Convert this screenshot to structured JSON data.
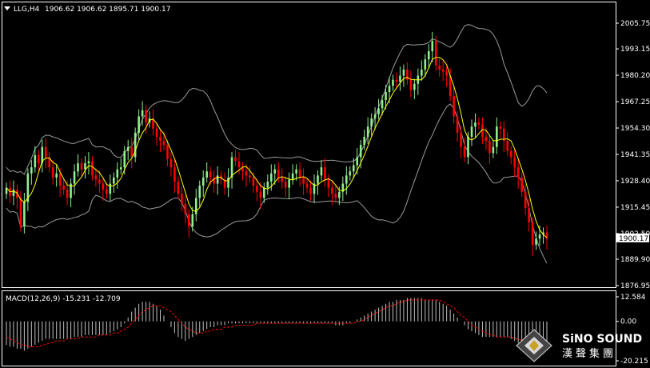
{
  "header": {
    "symbol": "LLG,H4",
    "ohlc": "1906.62 1906.62 1895.71 1900.17"
  },
  "colors": {
    "background": "#000000",
    "axis": "#ffffff",
    "bull": "#90ee90",
    "bear": "#ff0000",
    "bands": "#9a9a9a",
    "ma": "#ffff00",
    "macd_hist": "#c0c0c0",
    "macd_signal": "#ff0000",
    "price_tag_bg": "#ffffff",
    "price_tag_fg": "#000000"
  },
  "chart_data": {
    "type": "candlestick",
    "title": "LLG,H4",
    "price_axis": {
      "ticks": [
        "2005.75",
        "1993.15",
        "1980.20",
        "1967.25",
        "1954.30",
        "1941.35",
        "1928.40",
        "1915.45",
        "1902.50",
        "1889.90",
        "1876.95"
      ],
      "tick_values": [
        2005.75,
        1993.15,
        1980.2,
        1967.25,
        1954.3,
        1941.35,
        1928.4,
        1915.45,
        1902.5,
        1889.9,
        1876.95
      ],
      "last_price": "1900.17",
      "last_price_value": 1900.17
    },
    "candles_close": [
      1925,
      1921,
      1924,
      1920,
      1906,
      1918,
      1932,
      1935,
      1941,
      1937,
      1945,
      1940,
      1935,
      1930,
      1932,
      1926,
      1924,
      1920,
      1927,
      1933,
      1937,
      1934,
      1937,
      1938,
      1931,
      1929,
      1927,
      1924,
      1922,
      1927,
      1930,
      1934,
      1935,
      1943,
      1945,
      1940,
      1952,
      1960,
      1963,
      1957,
      1959,
      1954,
      1950,
      1948,
      1946,
      1939,
      1935,
      1928,
      1922,
      1917,
      1912,
      1906,
      1912,
      1920,
      1926,
      1930,
      1933,
      1930,
      1927,
      1931,
      1929,
      1925,
      1930,
      1940,
      1938,
      1935,
      1933,
      1931,
      1930,
      1926,
      1923,
      1920,
      1925,
      1928,
      1932,
      1934,
      1930,
      1928,
      1925,
      1929,
      1932,
      1934,
      1930,
      1927,
      1925,
      1922,
      1927,
      1931,
      1935,
      1929,
      1925,
      1922,
      1920,
      1923,
      1927,
      1931,
      1933,
      1936,
      1940,
      1946,
      1950,
      1955,
      1959,
      1961,
      1964,
      1968,
      1972,
      1975,
      1978,
      1977,
      1980,
      1983,
      1978,
      1973,
      1976,
      1980,
      1983,
      1988,
      1992,
      1997,
      1985,
      1983,
      1982,
      1980,
      1970,
      1960,
      1952,
      1945,
      1940,
      1950,
      1955,
      1957,
      1956,
      1950,
      1948,
      1942,
      1945,
      1955,
      1954,
      1948,
      1943,
      1940,
      1935,
      1930,
      1923,
      1915,
      1908,
      1897,
      1900,
      1902,
      1903,
      1900
    ],
    "macd": {
      "label": "MACD(12,26,9) -15.231 -12.709",
      "fast": 12,
      "slow": 26,
      "signal": 9,
      "value": -15.231,
      "signal_value": -12.709,
      "axis_ticks": [
        "12.584",
        "0.00",
        "-20.215"
      ],
      "axis_values": [
        12.584,
        0.0,
        -20.215
      ],
      "histogram": [
        -12,
        -13,
        -13,
        -14,
        -14,
        -15,
        -14,
        -13,
        -12,
        -11,
        -10,
        -9,
        -9,
        -9,
        -9,
        -9,
        -9,
        -9,
        -9,
        -8,
        -8,
        -8,
        -7,
        -7,
        -7,
        -7,
        -7,
        -7,
        -7,
        -6,
        -5,
        -4,
        -3,
        -1,
        2,
        5,
        7,
        9,
        10,
        10,
        10,
        9,
        8,
        6,
        3,
        0,
        -3,
        -6,
        -8,
        -9,
        -10,
        -9,
        -8,
        -7,
        -6,
        -5,
        -4,
        -3,
        -3,
        -2,
        -2,
        -2,
        -1,
        -1,
        -1,
        -1,
        -1,
        -1,
        -1,
        -1,
        -1,
        -1,
        -1,
        -1,
        -1,
        -1,
        -1,
        -1,
        -1,
        -1,
        -1,
        -1,
        -1,
        -1,
        -1,
        -1,
        -1,
        -1,
        -1,
        -1,
        -1,
        -1,
        -2,
        -2,
        -2,
        -1,
        -1,
        0,
        1,
        2,
        3,
        4,
        5,
        6,
        7,
        8,
        9,
        10,
        10,
        11,
        11,
        11,
        12,
        12,
        12,
        12,
        12,
        11,
        11,
        11,
        11,
        10,
        9,
        8,
        6,
        4,
        2,
        0,
        -2,
        -4,
        -5,
        -6,
        -7,
        -8,
        -8,
        -8,
        -8,
        -8,
        -8,
        -8,
        -8,
        -9,
        -10,
        -11,
        -12,
        -13,
        -14,
        -14,
        -15,
        -15,
        -15,
        -15
      ],
      "signal_line": [
        -8,
        -9,
        -10,
        -11,
        -12,
        -12,
        -13,
        -13,
        -13,
        -13,
        -12,
        -12,
        -11,
        -11,
        -10,
        -10,
        -10,
        -9,
        -9,
        -9,
        -9,
        -8,
        -8,
        -8,
        -8,
        -8,
        -7,
        -7,
        -7,
        -7,
        -6,
        -6,
        -5,
        -4,
        -3,
        -1,
        1,
        3,
        5,
        6,
        7,
        8,
        8,
        8,
        7,
        6,
        5,
        3,
        1,
        -1,
        -3,
        -4,
        -5,
        -6,
        -6,
        -6,
        -5,
        -5,
        -4,
        -4,
        -4,
        -3,
        -3,
        -3,
        -2,
        -2,
        -2,
        -2,
        -2,
        -2,
        -1,
        -1,
        -1,
        -1,
        -1,
        -1,
        -1,
        -1,
        -1,
        -1,
        -1,
        -1,
        -1,
        -1,
        -1,
        -1,
        -1,
        -1,
        -1,
        -1,
        -1,
        -1,
        -1,
        -1,
        -1,
        -1,
        -1,
        -1,
        0,
        0,
        1,
        2,
        3,
        4,
        5,
        6,
        7,
        8,
        8,
        9,
        10,
        10,
        11,
        11,
        11,
        11,
        11,
        11,
        11,
        11,
        11,
        11,
        10,
        9,
        8,
        7,
        5,
        3,
        2,
        0,
        -2,
        -3,
        -4,
        -5,
        -6,
        -7,
        -7,
        -8,
        -8,
        -8,
        -8,
        -8,
        -9,
        -9,
        -10,
        -11,
        -11,
        -12,
        -12,
        -12,
        -13
      ]
    }
  },
  "watermark": {
    "brand": "SiNO SOUND",
    "brand_cn": "漢聲集團"
  }
}
